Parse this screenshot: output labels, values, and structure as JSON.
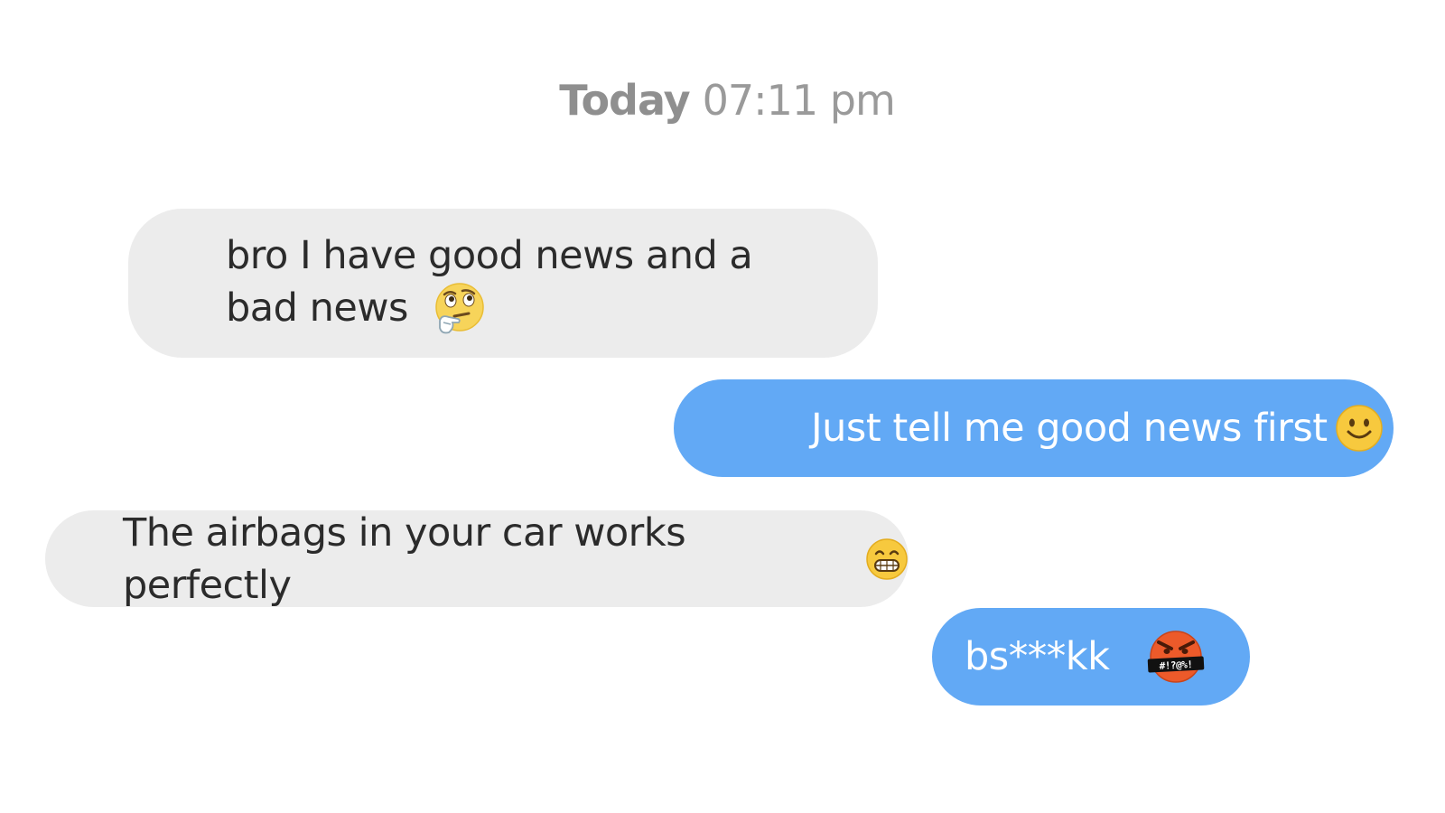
{
  "header": {
    "day": "Today",
    "time": "07:11 pm"
  },
  "messages": [
    {
      "sender": "incoming",
      "text": "bro I have good news and a bad news",
      "emoji": "thinking-face-icon"
    },
    {
      "sender": "outgoing",
      "text": "Just tell me good news first",
      "emoji": "smiling-face-icon"
    },
    {
      "sender": "incoming",
      "text": "The airbags in your car works perfectly",
      "emoji": "grinning-face-icon"
    },
    {
      "sender": "outgoing",
      "text": "bs***kk",
      "emoji": "face-with-symbols-icon",
      "emoji_text": "#!?@%!"
    }
  ],
  "colors": {
    "incoming_bubble": "#ececec",
    "outgoing_bubble": "#62a9f5",
    "timestamp": "#9a9a9a"
  }
}
